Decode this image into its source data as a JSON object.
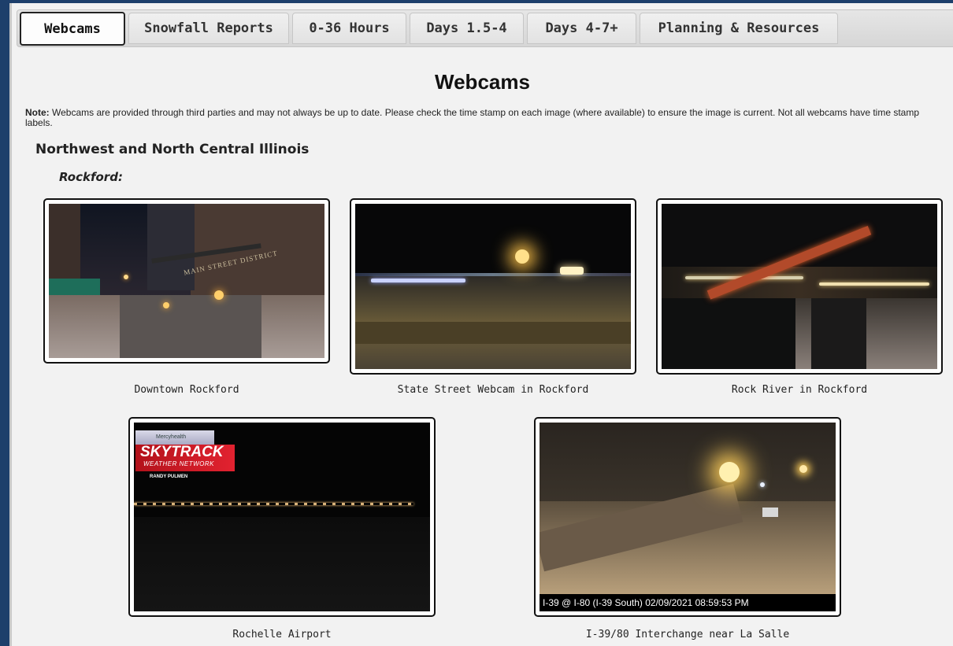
{
  "tabs": [
    {
      "label": "Webcams",
      "active": true
    },
    {
      "label": "Snowfall Reports",
      "active": false
    },
    {
      "label": "0-36 Hours",
      "active": false
    },
    {
      "label": "Days 1.5-4",
      "active": false
    },
    {
      "label": "Days 4-7+",
      "active": false
    },
    {
      "label": "Planning & Resources",
      "active": false
    }
  ],
  "page": {
    "title": "Webcams",
    "note_label": "Note:",
    "note_text": " Webcams are provided through third parties and may not always be up to date. Please check the time stamp on each image (where available) to ensure the image is current. Not all webcams have time stamp labels.",
    "region": "Northwest and North Central Illinois",
    "city": "Rockford:"
  },
  "webcams": [
    {
      "caption": "Downtown Rockford",
      "sign_text": "MAIN STREET DISTRICT"
    },
    {
      "caption": "State Street Webcam in Rockford"
    },
    {
      "caption": "Rock River in Rockford"
    },
    {
      "caption": "Rochelle Airport",
      "brand_top": "Mercyhealth",
      "brand_title": "SKYTRACK",
      "brand_subtitle": "WEATHER NETWORK",
      "brand_credit": "RANDY PULMEN"
    },
    {
      "caption": "I-39/80 Interchange near La Salle",
      "timestamp": "I-39 @ I-80 (I-39 South) 02/09/2021 08:59:53 PM"
    }
  ],
  "colors": {
    "page_background": "#1d3f6b",
    "content_background": "#f2f2f2",
    "active_tab_border": "#222222"
  }
}
